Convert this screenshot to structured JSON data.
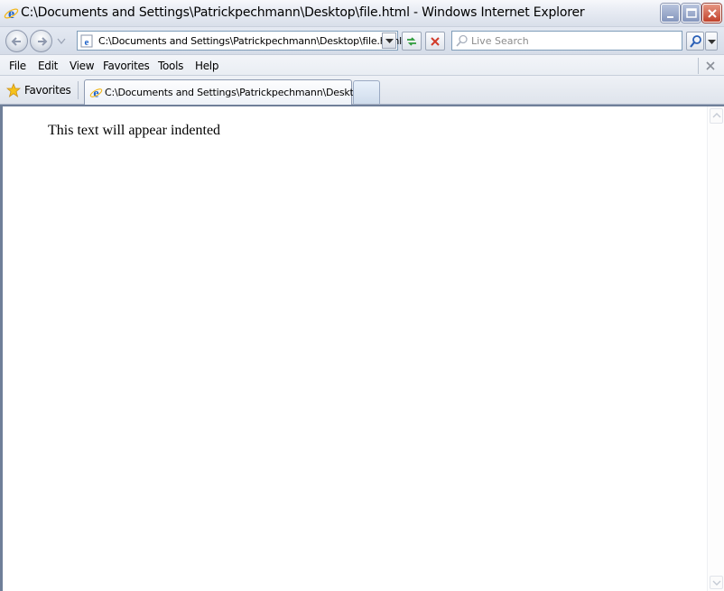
{
  "window": {
    "title": "C:\\Documents and Settings\\Patrickpechmann\\Desktop\\file.html - Windows Internet Explorer"
  },
  "address_bar": {
    "url": "C:\\Documents and Settings\\Patrickpechmann\\Desktop\\file.html"
  },
  "search": {
    "placeholder": "Live Search",
    "value": ""
  },
  "menu": {
    "items": [
      "File",
      "Edit",
      "View",
      "Favorites",
      "Tools",
      "Help"
    ]
  },
  "favorites": {
    "label": "Favorites"
  },
  "tabs": [
    {
      "label": "C:\\Documents and Settings\\Patrickpechmann\\Desktop...",
      "active": true
    }
  ],
  "page": {
    "text": "This text will appear indented"
  },
  "colors": {
    "window_frame": "#6f7f99",
    "close_button": "#c1422b",
    "ie_blue": "#1e62c8",
    "ie_ring": "#f2b71c"
  }
}
